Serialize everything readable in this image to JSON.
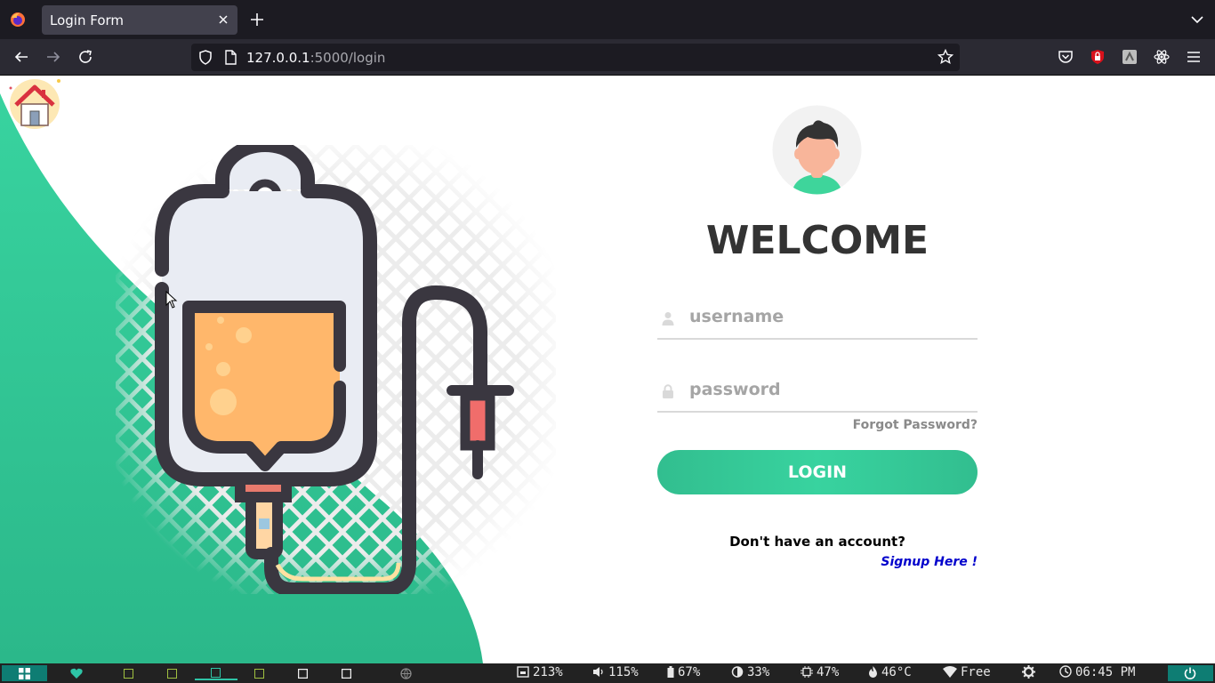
{
  "browser": {
    "tab_title": "Login Form",
    "url_host": "127.0.0.1",
    "url_path": ":5000/login"
  },
  "page": {
    "welcome": "WELCOME",
    "username_placeholder": "username",
    "password_placeholder": "password",
    "forgot_label": "Forgot Password?",
    "login_label": "LOGIN",
    "no_account_text": "Don't have an account?",
    "signup_label": "Signup Here !"
  },
  "colors": {
    "accent": "#32be8f",
    "accent_light": "#38d39f",
    "taskbar_bg": "#222222",
    "taskbar_accent": "#0e7d73"
  },
  "taskbar": {
    "workspaces": [
      "ws-1",
      "ws-2",
      "ws-3",
      "ws-4",
      "ws-5",
      "ws-6",
      "ws-7",
      "ws-8"
    ],
    "disk": "213%",
    "volume": "115%",
    "battery": "67%",
    "brightness": "33%",
    "cpu": "47%",
    "temperature": "46°C",
    "network": "Free",
    "clock": "06:45 PM"
  }
}
